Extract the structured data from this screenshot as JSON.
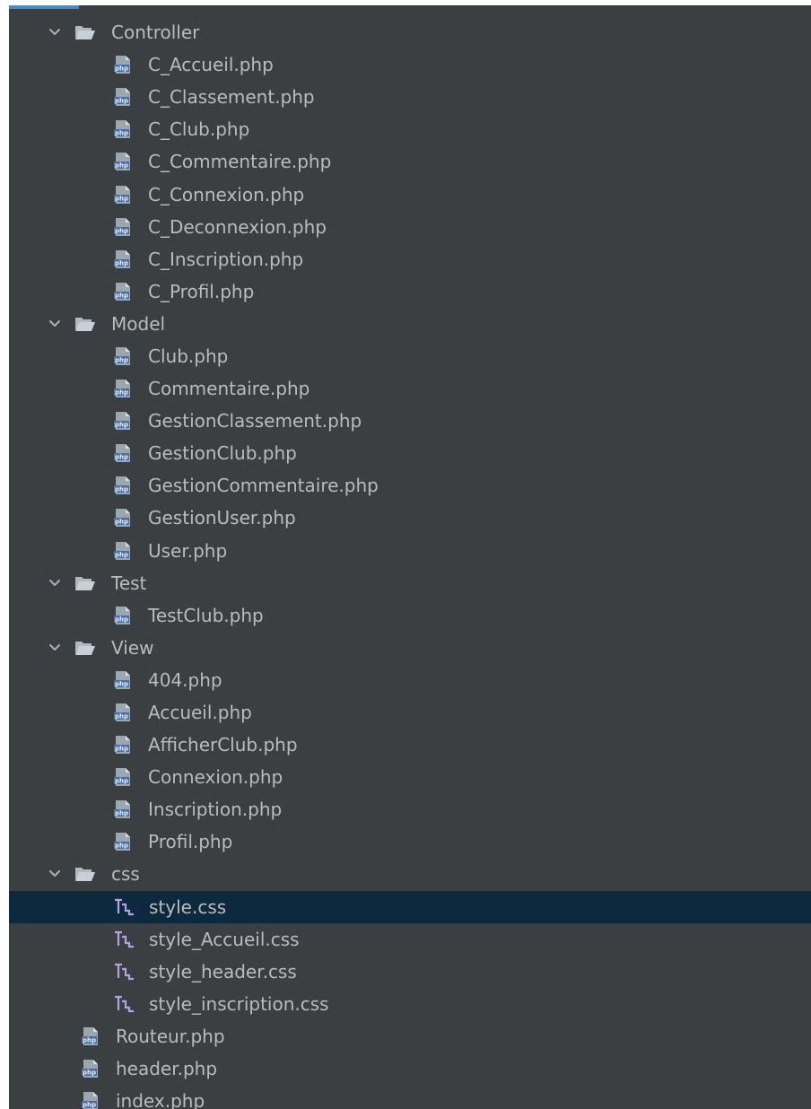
{
  "project_tree": {
    "items": [
      {
        "label": "Controller",
        "type": "folder",
        "depth": 0
      },
      {
        "label": "C_Accueil.php",
        "type": "php",
        "depth": 1
      },
      {
        "label": "C_Classement.php",
        "type": "php",
        "depth": 1
      },
      {
        "label": "C_Club.php",
        "type": "php",
        "depth": 1
      },
      {
        "label": "C_Commentaire.php",
        "type": "php",
        "depth": 1
      },
      {
        "label": "C_Connexion.php",
        "type": "php",
        "depth": 1
      },
      {
        "label": "C_Deconnexion.php",
        "type": "php",
        "depth": 1
      },
      {
        "label": "C_Inscription.php",
        "type": "php",
        "depth": 1
      },
      {
        "label": "C_Profil.php",
        "type": "php",
        "depth": 1
      },
      {
        "label": "Model",
        "type": "folder",
        "depth": 0
      },
      {
        "label": "Club.php",
        "type": "php",
        "depth": 1
      },
      {
        "label": "Commentaire.php",
        "type": "php",
        "depth": 1
      },
      {
        "label": "GestionClassement.php",
        "type": "php",
        "depth": 1
      },
      {
        "label": "GestionClub.php",
        "type": "php",
        "depth": 1
      },
      {
        "label": "GestionCommentaire.php",
        "type": "php",
        "depth": 1
      },
      {
        "label": "GestionUser.php",
        "type": "php",
        "depth": 1
      },
      {
        "label": "User.php",
        "type": "php",
        "depth": 1
      },
      {
        "label": "Test",
        "type": "folder",
        "depth": 0
      },
      {
        "label": "TestClub.php",
        "type": "php",
        "depth": 1
      },
      {
        "label": "View",
        "type": "folder",
        "depth": 0
      },
      {
        "label": "404.php",
        "type": "php",
        "depth": 1
      },
      {
        "label": "Accueil.php",
        "type": "php",
        "depth": 1
      },
      {
        "label": "AfficherClub.php",
        "type": "php",
        "depth": 1
      },
      {
        "label": "Connexion.php",
        "type": "php",
        "depth": 1
      },
      {
        "label": "Inscription.php",
        "type": "php",
        "depth": 1
      },
      {
        "label": "Profil.php",
        "type": "php",
        "depth": 1
      },
      {
        "label": "css",
        "type": "folder",
        "depth": 0
      },
      {
        "label": "style.css",
        "type": "css",
        "depth": 1,
        "selected": true
      },
      {
        "label": "style_Accueil.css",
        "type": "css",
        "depth": 1
      },
      {
        "label": "style_header.css",
        "type": "css",
        "depth": 1
      },
      {
        "label": "style_inscription.css",
        "type": "css",
        "depth": 1
      },
      {
        "label": "Routeur.php",
        "type": "php",
        "depth": 0
      },
      {
        "label": "header.php",
        "type": "php",
        "depth": 0
      },
      {
        "label": "index.php",
        "type": "php",
        "depth": 0
      }
    ]
  },
  "icons": {
    "folder": "folder-open-icon",
    "php": "php-file-icon",
    "css": "css-file-icon",
    "expand": "chevron-down-icon"
  },
  "colors": {
    "background": "#3c3f41",
    "text": "#bbbbbb",
    "selection": "#0d293e",
    "folder_icon": "#aeb9c0",
    "php_icon": "#9aa7b0",
    "php_badge": "#4a6ea9",
    "css_icon": "#b5a1e6"
  }
}
